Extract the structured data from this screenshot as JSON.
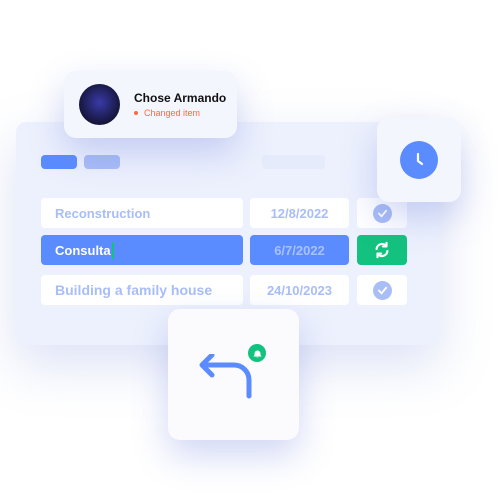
{
  "profile": {
    "name": "Chose Armando",
    "status": "Changed item",
    "status_color": "#ff6a3d"
  },
  "tabs": [
    {
      "active": true
    },
    {
      "active": false
    }
  ],
  "rows": [
    {
      "name": "Reconstruction",
      "date": "12/8/2022",
      "status": "check-icon"
    },
    {
      "name": "Consulta",
      "date": "6/7/2022",
      "status": "refresh-icon",
      "editing": true
    },
    {
      "name": "Building a family house",
      "date": "24/10/2023",
      "status": "check-icon"
    }
  ],
  "colors": {
    "accent": "#5b8cff",
    "success": "#13c27e",
    "muted": "#a9bdf7"
  },
  "icons": {
    "clock": "clock-icon",
    "undo": "undo-arrow-icon",
    "bell": "bell-icon"
  }
}
